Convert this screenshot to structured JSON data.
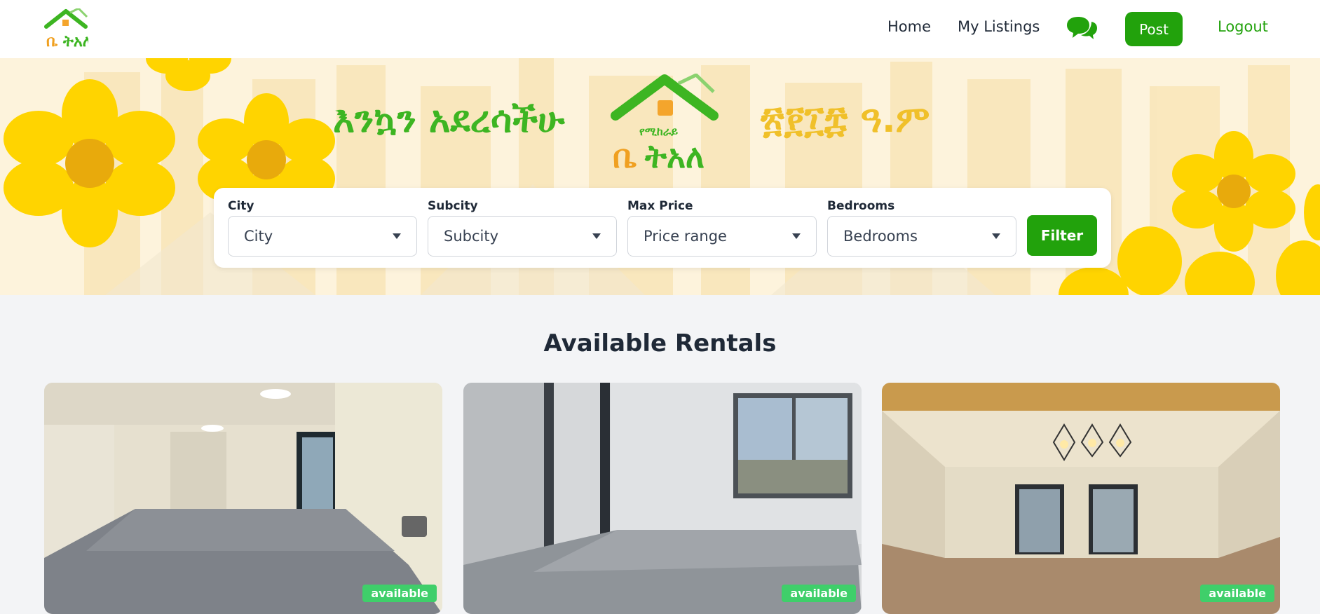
{
  "nav": {
    "logo_icon": "house-logo",
    "home": "Home",
    "my_listings": "My Listings",
    "chat_icon": "chat-bubbles-icon",
    "post": "Post",
    "logout": "Logout"
  },
  "hero": {
    "greeting": "እንኳን አደረሳችሁ",
    "year": "፳፻፲፰ ዓ.ም"
  },
  "filters": {
    "city": {
      "label": "City",
      "value": "City"
    },
    "subcity": {
      "label": "Subcity",
      "value": "Subcity"
    },
    "max_price": {
      "label": "Max Price",
      "value": "Price range"
    },
    "bedrooms": {
      "label": "Bedrooms",
      "value": "Bedrooms"
    },
    "button": "Filter"
  },
  "section": {
    "title": "Available Rentals"
  },
  "listings": [
    {
      "status": "available"
    },
    {
      "status": "available"
    },
    {
      "status": "available"
    }
  ],
  "colors": {
    "brand_green": "#22a20c",
    "flower_yellow": "#ffd700",
    "badge_green": "#3fcf6a"
  }
}
